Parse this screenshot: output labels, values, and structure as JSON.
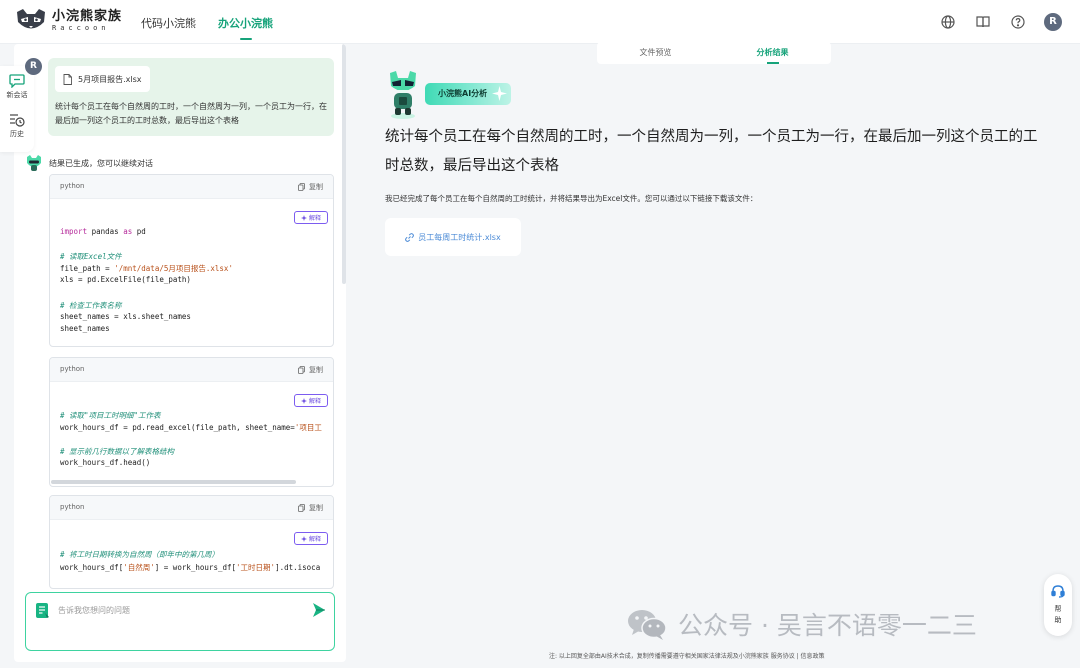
{
  "header": {
    "logo_cn": "小浣熊家族",
    "logo_en": "Raccoon",
    "tabs": [
      {
        "label": "代码小浣熊",
        "active": false
      },
      {
        "label": "办公小浣熊",
        "active": true
      }
    ],
    "avatar_initial": "R",
    "icons": [
      "globe-icon",
      "book-icon",
      "help-circle-icon"
    ]
  },
  "rail": {
    "items": [
      {
        "label": "新会话",
        "icon": "new-chat-icon"
      },
      {
        "label": "历史",
        "icon": "history-icon"
      }
    ]
  },
  "chat": {
    "user_avatar": "R",
    "attachment": "5月项目报告.xlsx",
    "user_message": "统计每个员工在每个自然周的工时，一个自然周为一列，一个员工为一行，在最后加一列这个员工的工时总数，最后导出这个表格",
    "bot_status": "结果已生成，您可以继续对话",
    "code_blocks": [
      {
        "lang": "python",
        "copy_label": "复制",
        "explain_label": "解释",
        "lines": [
          {
            "kind": "code",
            "text": "import pandas as pd"
          },
          {
            "kind": "blank",
            "text": ""
          },
          {
            "kind": "comment",
            "text": "# 读取Excel文件"
          },
          {
            "kind": "code",
            "text": "file_path = '/mnt/data/5月项目报告.xlsx'"
          },
          {
            "kind": "code",
            "text": "xls = pd.ExcelFile(file_path)"
          },
          {
            "kind": "blank",
            "text": ""
          },
          {
            "kind": "comment",
            "text": "# 检查工作表名称"
          },
          {
            "kind": "code",
            "text": "sheet_names = xls.sheet_names"
          },
          {
            "kind": "code",
            "text": "sheet_names"
          }
        ]
      },
      {
        "lang": "python",
        "copy_label": "复制",
        "explain_label": "解释",
        "lines": [
          {
            "kind": "comment",
            "text": "# 读取\"项目工时明细\"工作表"
          },
          {
            "kind": "code",
            "text": "work_hours_df = pd.read_excel(file_path, sheet_name='项目工"
          },
          {
            "kind": "blank",
            "text": ""
          },
          {
            "kind": "comment",
            "text": "# 显示前几行数据以了解表格结构"
          },
          {
            "kind": "code",
            "text": "work_hours_df.head()"
          }
        ]
      },
      {
        "lang": "python",
        "copy_label": "复制",
        "explain_label": "解释",
        "lines": [
          {
            "kind": "comment",
            "text": "# 将工时日期转换为自然周（即年中的第几周）"
          },
          {
            "kind": "code",
            "text": "work_hours_df['自然周'] = work_hours_df['工时日期'].dt.isoca"
          }
        ]
      }
    ],
    "input_placeholder": "告诉我您想问的问题"
  },
  "result": {
    "tabs": [
      {
        "label": "文件预览",
        "active": false
      },
      {
        "label": "分析结果",
        "active": true
      }
    ],
    "badge": "小浣熊AI分析",
    "query": "统计每个员工在每个自然周的工时，一个自然周为一列，一个员工为一行，在最后加一列这个员工的工时总数，最后导出这个表格",
    "summary": "我已经完成了每个员工在每个自然周的工时统计，并将结果导出为Excel文件。您可以通过以下链接下载该文件：",
    "download_link": "员工每周工时统计.xlsx"
  },
  "watermark": "公众号 · 吴言不语零一二三",
  "disclaimer": "注: 以上回复全部由AI技术合成，复制传播需要遵守相关国家法律法规及小浣熊家族 服务协议 | 信息政策",
  "help_label": "帮助",
  "colors": {
    "accent": "#16a37a",
    "input_border": "#3ed3a0",
    "explain": "#6a4ae0",
    "link": "#4a8ad6"
  }
}
